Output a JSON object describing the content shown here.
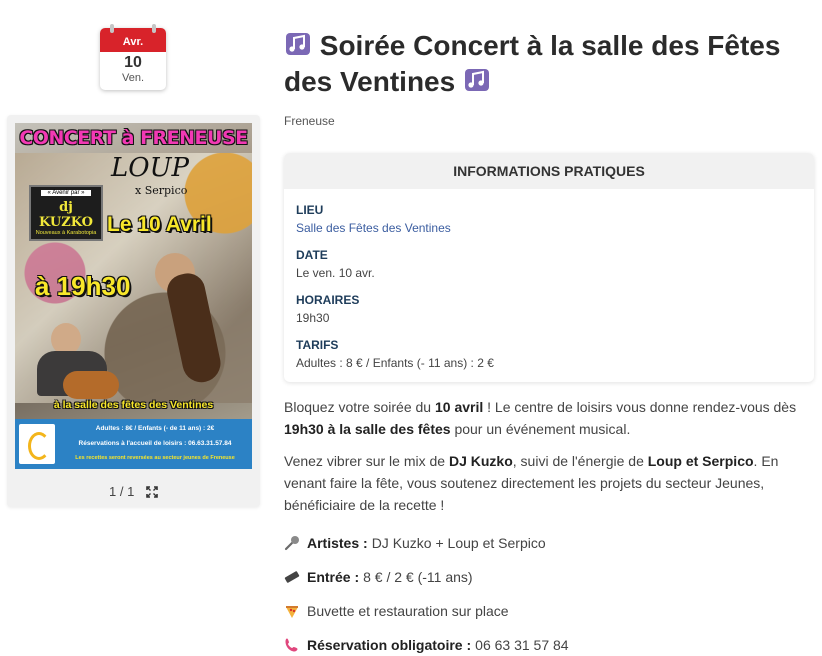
{
  "calendar": {
    "month": "Avr.",
    "day": "10",
    "weekday": "Ven."
  },
  "poster": {
    "title": "CONCERT à FRENEUSE",
    "headliner": "LOUP",
    "headliner_sub": "x Serpico",
    "dj_small": "« Avenir par »",
    "dj_name": "dj KUZKO",
    "dj_sub": "Nouveaux à Karabotopia",
    "date": "Le 10 Avril",
    "time": "à 19h30",
    "venue": "à la salle des fêtes des Ventines",
    "band_line1": "Adultes : 8€ / Enfants (- de 11 ans) : 2€",
    "band_line2": "Réservations à l'accueil de loisirs : 06.63.31.57.84",
    "band_line3": "Les recettes seront reversées au secteur jeunes de Freneuse"
  },
  "pager": {
    "counter": "1 / 1"
  },
  "event": {
    "title": "Soirée Concert à la salle des Fêtes des Ventines",
    "place": "Freneuse"
  },
  "info": {
    "heading": "INFORMATIONS PRATIQUES",
    "lieu_label": "LIEU",
    "lieu_value": "Salle des Fêtes des Ventines",
    "date_label": "DATE",
    "date_value": "Le ven. 10 avr.",
    "horaires_label": "HORAIRES",
    "horaires_value": "19h30",
    "tarifs_label": "TARIFS",
    "tarifs_value": "Adultes : 8 € / Enfants (- 11 ans) : 2 €"
  },
  "description": {
    "p1_a": "Bloquez votre soirée du ",
    "p1_b": "10 avril",
    "p1_c": " ! Le centre de loisirs vous donne rendez-vous dès ",
    "p1_d": "19h30 à la salle des fêtes",
    "p1_e": " pour un événement musical.",
    "p2_a": "Venez vibrer sur le mix de ",
    "p2_b": "DJ Kuzko",
    "p2_c": ", suivi de l'énergie de ",
    "p2_d": "Loup et Serpico",
    "p2_e": ". En venant faire la fête, vous soutenez directement les projets du secteur Jeunes, bénéficiaire de la recette !"
  },
  "bullets": [
    {
      "icon": "microphone-icon",
      "label": "Artistes :",
      "value": "DJ Kuzko + Loup et Serpico"
    },
    {
      "icon": "ticket-icon",
      "label": "Entrée :",
      "value": "8 € / 2 € (-11 ans)"
    },
    {
      "icon": "pizza-icon",
      "label": "",
      "value": "Buvette et restauration sur place"
    },
    {
      "icon": "phone-icon",
      "label": "Réservation obligatoire :",
      "value": "06 63 31 57 84"
    }
  ],
  "colors": {
    "accent_red": "#d8232a",
    "music_icon": "#7b68b5",
    "label_navy": "#1e3c5a",
    "link_blue": "#3b5da0"
  }
}
